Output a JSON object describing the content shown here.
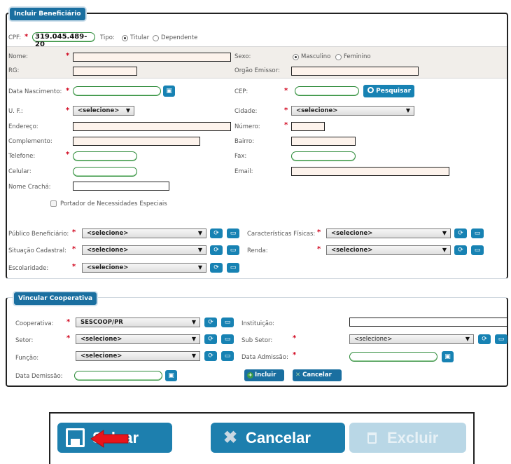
{
  "form": {
    "legend": "Incluir Beneficiário",
    "cpf_label": "CPF:",
    "cpf_value": "319.045.489-20",
    "tipo_label": "Tipo:",
    "tipo_titular": "Titular",
    "tipo_dependente": "Dependente",
    "nome_label": "Nome:",
    "sexo_label": "Sexo:",
    "sexo_masculino": "Masculino",
    "sexo_feminino": "Feminino",
    "rg_label": "RG:",
    "orgao_label": "Orgão Emissor:",
    "nascimento_label": "Data Nascimento:",
    "cep_label": "CEP:",
    "pesquisar_label": "Pesquisar",
    "uf_label": "U. F.:",
    "uf_value": "<selecione>",
    "cidade_label": "Cidade:",
    "cidade_value": "<selecione>",
    "endereco_label": "Endereço:",
    "numero_label": "Número:",
    "complemento_label": "Complemento:",
    "bairro_label": "Bairro:",
    "telefone_label": "Telefone:",
    "fax_label": "Fax:",
    "celular_label": "Celular:",
    "email_label": "Email:",
    "cracha_label": "Nome Crachá:",
    "pne_label": "Portador de Necessidades Especiais",
    "publico_label": "Público Beneficiário:",
    "publico_value": "<selecione>",
    "caracteristicas_label": "Características Físicas:",
    "caracteristicas_value": "<selecione>",
    "situacao_label": "Situação Cadastral:",
    "situacao_value": "<selecione>",
    "renda_label": "Renda:",
    "renda_value": "<selecione>",
    "escolaridade_label": "Escolaridade:",
    "escolaridade_value": "<selecione>"
  },
  "coop": {
    "legend": "Vincular Cooperativa",
    "cooperativa_label": "Cooperativa:",
    "cooperativa_value": "SESCOOP/PR",
    "instituicao_label": "Instituição:",
    "setor_label": "Setor:",
    "setor_value": "<selecione>",
    "subsetor_label": "Sub Setor:",
    "subsetor_value": "<selecione>",
    "funcao_label": "Função:",
    "funcao_value": "<selecione>",
    "admissao_label": "Data Admissão:",
    "demissao_label": "Data Demissão:",
    "incluir_label": "Incluir",
    "cancelar_label": "Cancelar"
  },
  "footer": {
    "salvar_label": "Salvar",
    "cancelar_label": "Cancelar",
    "excluir_label": "Excluir"
  },
  "colors": {
    "accent": "#1782b3",
    "legend": "#1a6fa0",
    "required": "#d0021b",
    "annotation_arrow": "#e8141b"
  }
}
